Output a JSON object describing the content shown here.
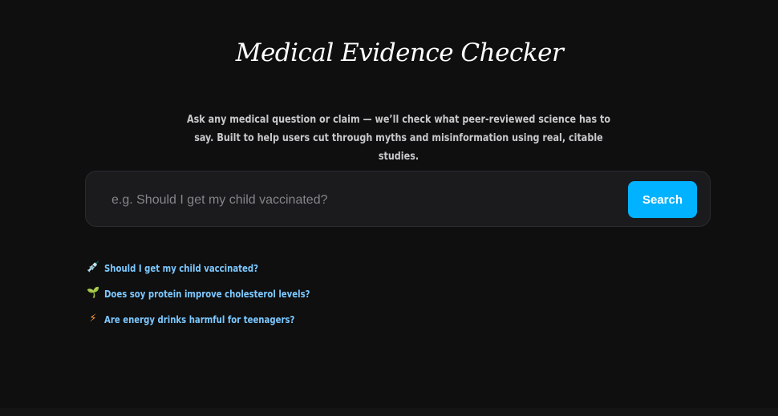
{
  "header": {
    "title": "Medical Evidence Checker",
    "subtitle": "Ask any medical question or claim — we’ll check what peer-reviewed science has to say. Built to help users cut through myths and misinformation using real, citable studies."
  },
  "search": {
    "placeholder": "e.g. Should I get my child vaccinated?",
    "value": "",
    "button_label": "Search",
    "button_color": "#00b2ff"
  },
  "examples": [
    {
      "icon": "syringe-icon",
      "glyph": "💉",
      "text": "Should I get my child vaccinated?"
    },
    {
      "icon": "seedling-icon",
      "glyph": "🌱",
      "text": "Does soy protein improve cholesterol levels?"
    },
    {
      "icon": "lightning-icon",
      "glyph": "⚡",
      "text": "Are energy drinks harmful for teenagers?"
    }
  ],
  "colors": {
    "background": "#0f0f10",
    "link": "#7cc8ff",
    "accent": "#00b2ff"
  }
}
